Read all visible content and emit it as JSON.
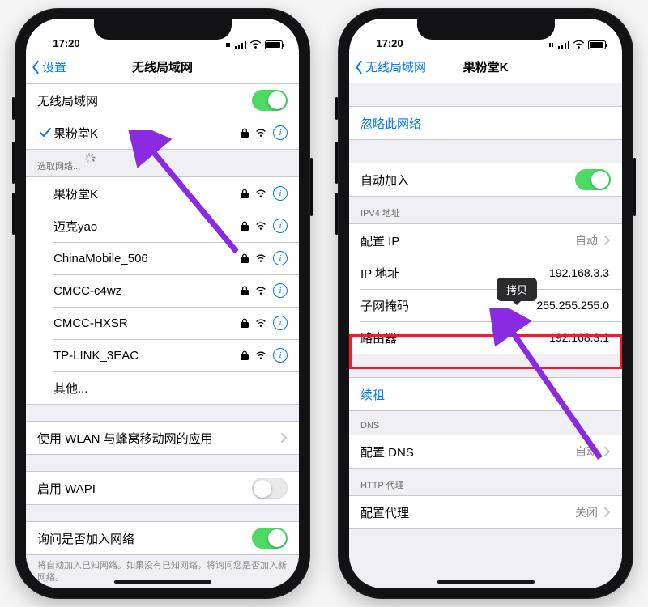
{
  "colors": {
    "accent_blue": "#007aff",
    "switch_green": "#4cd964",
    "highlight_red": "#ff1430",
    "arrow_purple": "#8a2be2"
  },
  "left": {
    "status_time": "17:20",
    "nav_back_label": "设置",
    "nav_title": "无线局域网",
    "wifi_toggle_label": "无线局域网",
    "joined_network_name": "果粉堂K",
    "section_choose_label": "选取网络...",
    "networks": [
      {
        "name": "果粉堂K",
        "locked": true
      },
      {
        "name": "迈克yao",
        "locked": true
      },
      {
        "name": "ChinaMobile_506",
        "locked": true
      },
      {
        "name": "CMCC-c4wz",
        "locked": true
      },
      {
        "name": "CMCC-HXSR",
        "locked": true
      },
      {
        "name": "TP-LINK_3EAC",
        "locked": true
      }
    ],
    "other_label": "其他...",
    "wlan_apps_label": "使用 WLAN 与蜂窝移动网的应用",
    "wapi_label": "启用 WAPI",
    "ask_join_label": "询问是否加入网络",
    "ask_join_footer": "将自动加入已知网络。如果没有已知网络，将询问您是否加入新网络。"
  },
  "right": {
    "status_time": "17:20",
    "nav_back_label": "无线局域网",
    "nav_title": "果粉堂K",
    "forget_label": "忽略此网络",
    "auto_join_label": "自动加入",
    "ipv4_header": "IPV4 地址",
    "configure_ip_label": "配置 IP",
    "configure_ip_value": "自动",
    "ip_address_label": "IP 地址",
    "ip_address_value": "192.168.3.3",
    "subnet_label": "子网掩码",
    "subnet_value": "255.255.255.0",
    "router_label": "路由器",
    "router_value": "192.168.3.1",
    "tooltip_copy": "拷贝",
    "renew_label": "续租",
    "dns_header": "DNS",
    "configure_dns_label": "配置 DNS",
    "configure_dns_value": "自动",
    "http_proxy_header": "HTTP 代理",
    "configure_proxy_label": "配置代理",
    "configure_proxy_value": "关闭"
  }
}
